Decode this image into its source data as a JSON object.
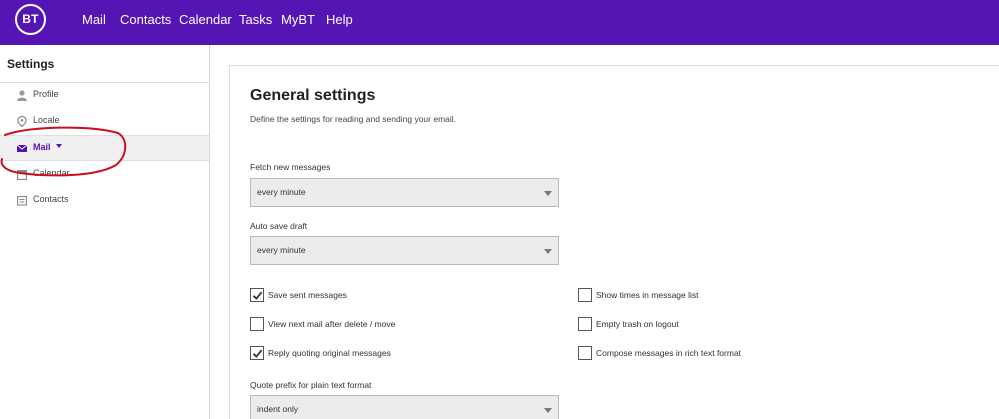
{
  "brand": {
    "logo_text": "BT",
    "accent": "#5514b4"
  },
  "topnav": [
    {
      "key": "mail",
      "label": "Mail"
    },
    {
      "key": "contacts",
      "label": "Contacts"
    },
    {
      "key": "calendar",
      "label": "Calendar"
    },
    {
      "key": "tasks",
      "label": "Tasks"
    },
    {
      "key": "mybt",
      "label": "MyBT"
    },
    {
      "key": "help",
      "label": "Help"
    }
  ],
  "sidebar": {
    "title": "Settings",
    "items": [
      {
        "label": "Profile",
        "icon": "person-icon"
      },
      {
        "label": "Locale",
        "icon": "location-pin-icon"
      },
      {
        "label": "Mail",
        "icon": "envelope-icon",
        "active": true
      },
      {
        "label": "Calendar",
        "icon": "calendar-icon"
      },
      {
        "label": "Contacts",
        "icon": "contacts-card-icon"
      }
    ]
  },
  "main": {
    "title": "General settings",
    "subtitle": "Define the settings for reading and sending your email.",
    "fetch": {
      "label": "Fetch new messages",
      "value": "every minute"
    },
    "autosave": {
      "label": "Auto save draft",
      "value": "every minute"
    },
    "checkboxes": [
      {
        "label": "Save sent messages",
        "checked": true
      },
      {
        "label": "View next mail after delete / move",
        "checked": false
      },
      {
        "label": "Reply quoting original messages",
        "checked": true
      },
      {
        "label": "Show times in message list",
        "checked": false
      },
      {
        "label": "Empty trash on logout",
        "checked": false
      },
      {
        "label": "Compose messages in rich text format",
        "checked": false
      }
    ],
    "quote_prefix": {
      "label": "Quote prefix for plain text format",
      "value": "indent only"
    }
  }
}
